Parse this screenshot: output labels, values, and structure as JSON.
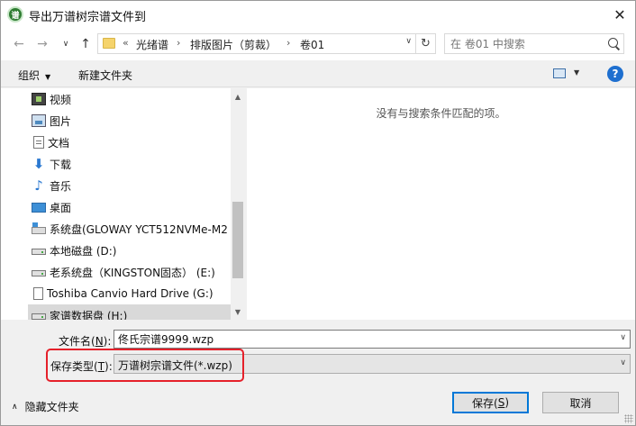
{
  "window": {
    "title": "导出万谱树宗谱文件到",
    "close_glyph": "✕"
  },
  "nav": {
    "back": "←",
    "forward": "→",
    "recent": "∨",
    "up": "↑"
  },
  "address": {
    "overflow": "«",
    "crumbs": [
      "光绪谱",
      "排版图片（剪裁）",
      "卷01"
    ],
    "separator": "›",
    "dropdown": "∨",
    "refresh": "↻"
  },
  "search": {
    "placeholder": "在 卷01 中搜索"
  },
  "toolbar": {
    "organize": "组织",
    "organize_caret": "▼",
    "new_folder": "新建文件夹",
    "view_caret": "▼",
    "help": "?"
  },
  "sidebar": {
    "items": [
      {
        "label": "视频",
        "icon": "video-icon"
      },
      {
        "label": "图片",
        "icon": "picture-icon"
      },
      {
        "label": "文档",
        "icon": "document-icon"
      },
      {
        "label": "下载",
        "icon": "download-icon"
      },
      {
        "label": "音乐",
        "icon": "music-icon"
      },
      {
        "label": "桌面",
        "icon": "desktop-icon"
      },
      {
        "label": "系统盘(GLOWAY YCT512NVMe-M2",
        "icon": "system-drive-icon"
      },
      {
        "label": "本地磁盘 (D:)",
        "icon": "drive-icon"
      },
      {
        "label": "老系统盘（KINGSTON固态） (E:)",
        "icon": "drive-icon"
      },
      {
        "label": "Toshiba Canvio Hard Drive (G:)",
        "icon": "external-drive-icon"
      },
      {
        "label": "家谱数据盘 (H:)",
        "icon": "drive-icon"
      }
    ],
    "scroll_up": "▲",
    "scroll_down": "▼"
  },
  "content": {
    "empty_message": "没有与搜索条件匹配的项。"
  },
  "form": {
    "filename_label": "文件名(",
    "filename_key": "N",
    "filename_suffix": "):",
    "filename_value": "佟氏宗谱9999.wzp",
    "filetype_label": "保存类型(",
    "filetype_key": "T",
    "filetype_suffix": "):",
    "filetype_value": "万谱树宗谱文件(*.wzp)",
    "dropdown": "∨"
  },
  "footer": {
    "chevron": "∧",
    "hide_folders": "隐藏文件夹",
    "save_label": "保存(",
    "save_key": "S",
    "save_suffix": ")",
    "cancel_label": "取消"
  },
  "colors": {
    "highlight": "#e5202a",
    "primary_border": "#0078d7",
    "folder": "#f5d36b",
    "help": "#1e6fcf"
  }
}
